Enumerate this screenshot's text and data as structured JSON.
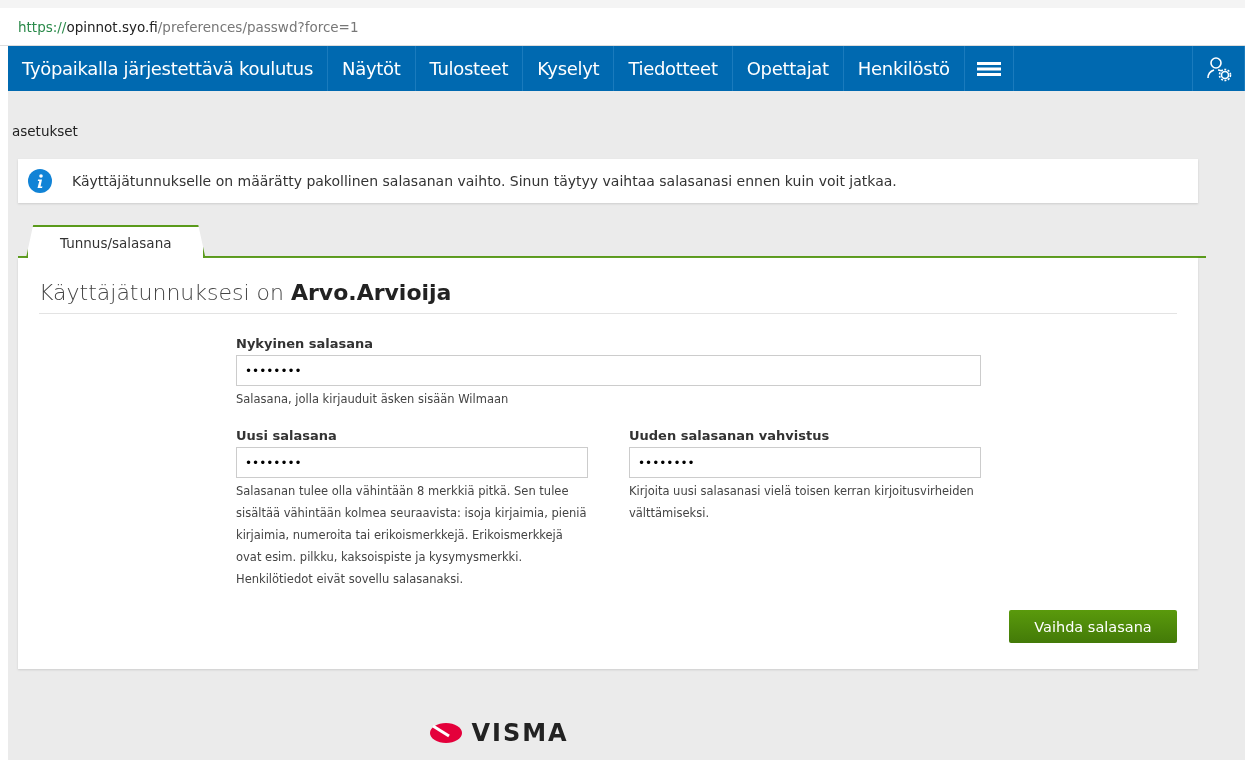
{
  "address_bar": {
    "scheme": "https://",
    "host": "opinnot.syo.fi",
    "path": "/preferences/passwd?force=1"
  },
  "nav": {
    "items": [
      {
        "label": "Työpaikalla järjestettävä koulutus"
      },
      {
        "label": "Näytöt"
      },
      {
        "label": "Tulosteet"
      },
      {
        "label": "Kyselyt"
      },
      {
        "label": "Tiedotteet"
      },
      {
        "label": "Opettajat"
      },
      {
        "label": "Henkilöstö"
      }
    ]
  },
  "breadcrumb": "asetukset",
  "notice": "Käyttäjätunnukselle on määrätty pakollinen salasanan vaihto. Sinun täytyy vaihtaa salasanasi ennen kuin voit jatkaa.",
  "tabs": [
    {
      "label": "Tunnus/salasana",
      "selected": true
    }
  ],
  "heading": "Käyttäjätunnuksesi on **Arvo.Arvioija**",
  "fields": [
    {
      "label": "Nykyinen salasana",
      "value": "••••••••",
      "help": "Salasana, jolla kirjauduit äsken sisään Wilmaan",
      "wide": true
    },
    {
      "label": "Uusi salasana",
      "value": "••••••••",
      "help": "Salasanan tulee olla vähintään 8 merkkiä pitkä. Sen tulee sisältää vähintään kolmea seuraavista: isoja kirjaimia, pieniä kirjaimia, numeroita tai erikoismerkkejä. Erikoismerkkejä ovat esim. pilkku, kaksoispiste ja kysymysmerkki. Henkilötiedot eivät sovellu salasanaksi.",
      "wide": false
    },
    {
      "label": "Uuden salasanan vahvistus",
      "value": "••••••••",
      "help": "Kirjoita uusi salasanasi vielä toisen kerran kirjoitusvirheiden välttämiseksi.",
      "wide": false
    }
  ],
  "submit": "Vaihda salasana",
  "footer_logo": "VISMA"
}
